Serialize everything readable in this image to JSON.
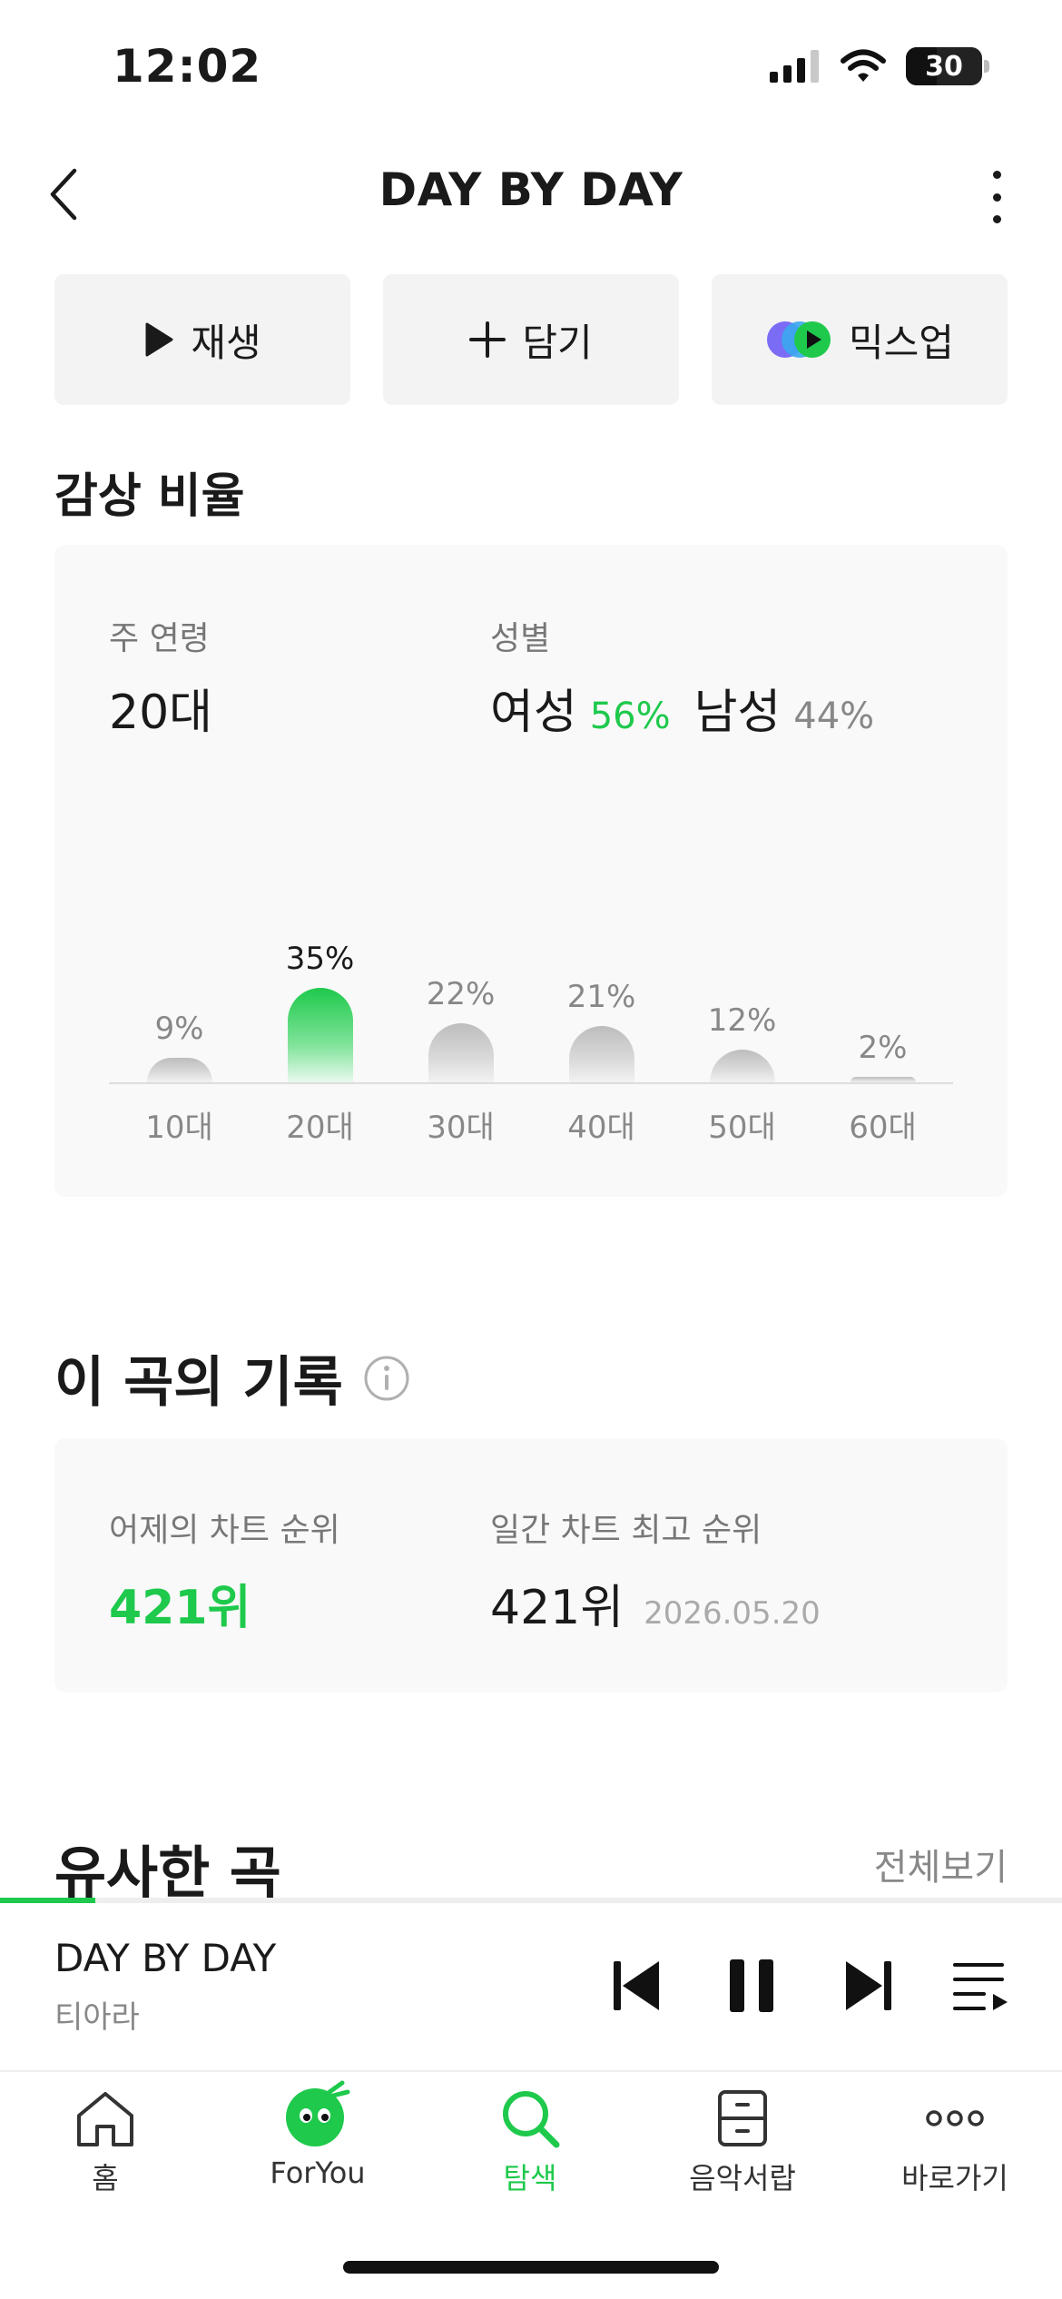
{
  "status_bar": {
    "time": "12:02",
    "battery": "30"
  },
  "header": {
    "title": "DAY BY DAY"
  },
  "actions": [
    {
      "label": "재생",
      "icon": "play-icon"
    },
    {
      "label": "담기",
      "icon": "plus-icon"
    },
    {
      "label": "믹스업",
      "icon": "mixup-icon"
    }
  ],
  "listening_ratio": {
    "title": "감상 비율",
    "main_age_label": "주 연령",
    "main_age_value": "20대",
    "gender_label": "성별",
    "female_label": "여성",
    "female_pct": "56%",
    "male_label": "남성",
    "male_pct": "44%",
    "accent_color": "#1ec94c"
  },
  "chart_data": {
    "type": "bar",
    "categories": [
      "10대",
      "20대",
      "30대",
      "40대",
      "50대",
      "60대"
    ],
    "values": [
      9,
      35,
      22,
      21,
      12,
      2
    ],
    "value_labels": [
      "9%",
      "35%",
      "22%",
      "21%",
      "12%",
      "2%"
    ],
    "highlight_index": 1,
    "ylim": [
      0,
      35
    ],
    "grid": false
  },
  "record": {
    "title": "이 곡의 기록",
    "yesterday_label": "어제의 차트 순위",
    "yesterday_value": "421위",
    "best_label": "일간 차트 최고 순위",
    "best_value": "421위",
    "best_date": "2026.05.20"
  },
  "similar": {
    "title": "유사한 곡",
    "view_all": "전체보기"
  },
  "player": {
    "title": "DAY BY DAY",
    "artist": "티아라",
    "progress": 0.09
  },
  "tabs": [
    {
      "label": "홈",
      "icon": "home-icon",
      "active": false
    },
    {
      "label": "ForYou",
      "icon": "foryou-character-icon",
      "active": false
    },
    {
      "label": "탐색",
      "icon": "search-icon",
      "active": true
    },
    {
      "label": "음악서랍",
      "icon": "drawer-icon",
      "active": false
    },
    {
      "label": "바로가기",
      "icon": "more-dots-icon",
      "active": false
    }
  ]
}
